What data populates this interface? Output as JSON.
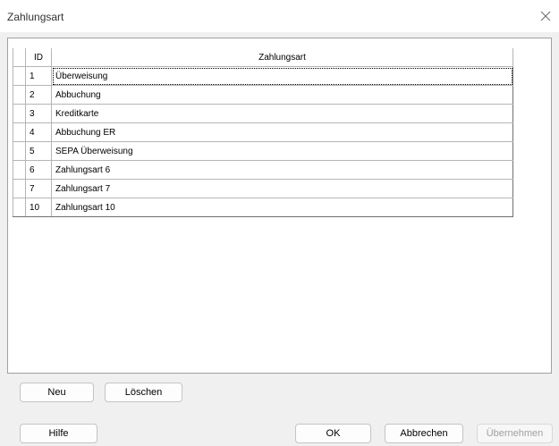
{
  "window": {
    "title": "Zahlungsart"
  },
  "icons": {
    "close": "close-icon"
  },
  "table": {
    "columns": [
      "ID",
      "Zahlungsart"
    ],
    "rows": [
      {
        "id": "1",
        "name": "Überweisung"
      },
      {
        "id": "2",
        "name": "Abbuchung"
      },
      {
        "id": "3",
        "name": "Kreditkarte"
      },
      {
        "id": "4",
        "name": "Abbuchung ER"
      },
      {
        "id": "5",
        "name": "SEPA Überweisung"
      },
      {
        "id": "6",
        "name": "Zahlungsart 6"
      },
      {
        "id": "7",
        "name": "Zahlungsart 7"
      },
      {
        "id": "10",
        "name": "Zahlungsart 10"
      }
    ],
    "selected_row": 0
  },
  "panel_buttons": {
    "new_label": "Neu",
    "delete_label": "Löschen"
  },
  "footer": {
    "help_label": "Hilfe",
    "ok_label": "OK",
    "cancel_label": "Abbrechen",
    "apply_label": "Übernehmen",
    "apply_enabled": false
  }
}
